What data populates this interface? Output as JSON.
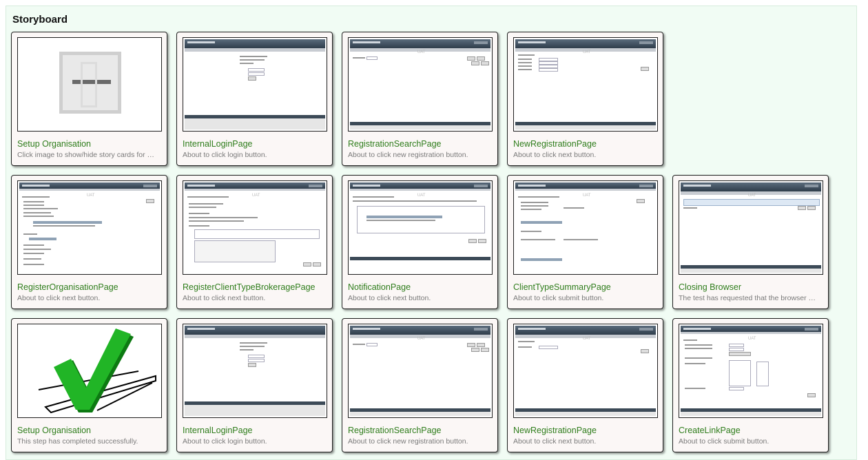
{
  "storyboard": {
    "title": "Storyboard",
    "cards": [
      {
        "title": "Setup Organisation",
        "desc": "Click image to show/hide story cards for …"
      },
      {
        "title": "InternalLoginPage",
        "desc": "About to click login button."
      },
      {
        "title": "RegistrationSearchPage",
        "desc": "About to click new registration button."
      },
      {
        "title": "NewRegistrationPage",
        "desc": "About to click next button."
      },
      {
        "title": "RegisterOrganisationPage",
        "desc": "About to click next button."
      },
      {
        "title": "RegisterClientTypeBrokeragePage",
        "desc": "About to click next button."
      },
      {
        "title": "NotificationPage",
        "desc": "About to click next button."
      },
      {
        "title": "ClientTypeSummaryPage",
        "desc": "About to click submit button."
      },
      {
        "title": "Closing Browser",
        "desc": "The test has requested that the browser …"
      },
      {
        "title": "Setup Organisation",
        "desc": "This step has completed successfully."
      },
      {
        "title": "InternalLoginPage",
        "desc": "About to click login button."
      },
      {
        "title": "RegistrationSearchPage",
        "desc": "About to click new registration button."
      },
      {
        "title": "NewRegistrationPage",
        "desc": "About to click next button."
      },
      {
        "title": "CreateLinkPage",
        "desc": "About to click submit button."
      }
    ]
  },
  "thumbs": {
    "login_header": "New Zealand Customs Service",
    "tsw_header": "Trade Single Window",
    "uat": "UAT"
  },
  "colors": {
    "link": "#2f7d1c",
    "desc": "#7a7a7a",
    "panel": "#f1fcf4",
    "check": "#16a11e"
  }
}
